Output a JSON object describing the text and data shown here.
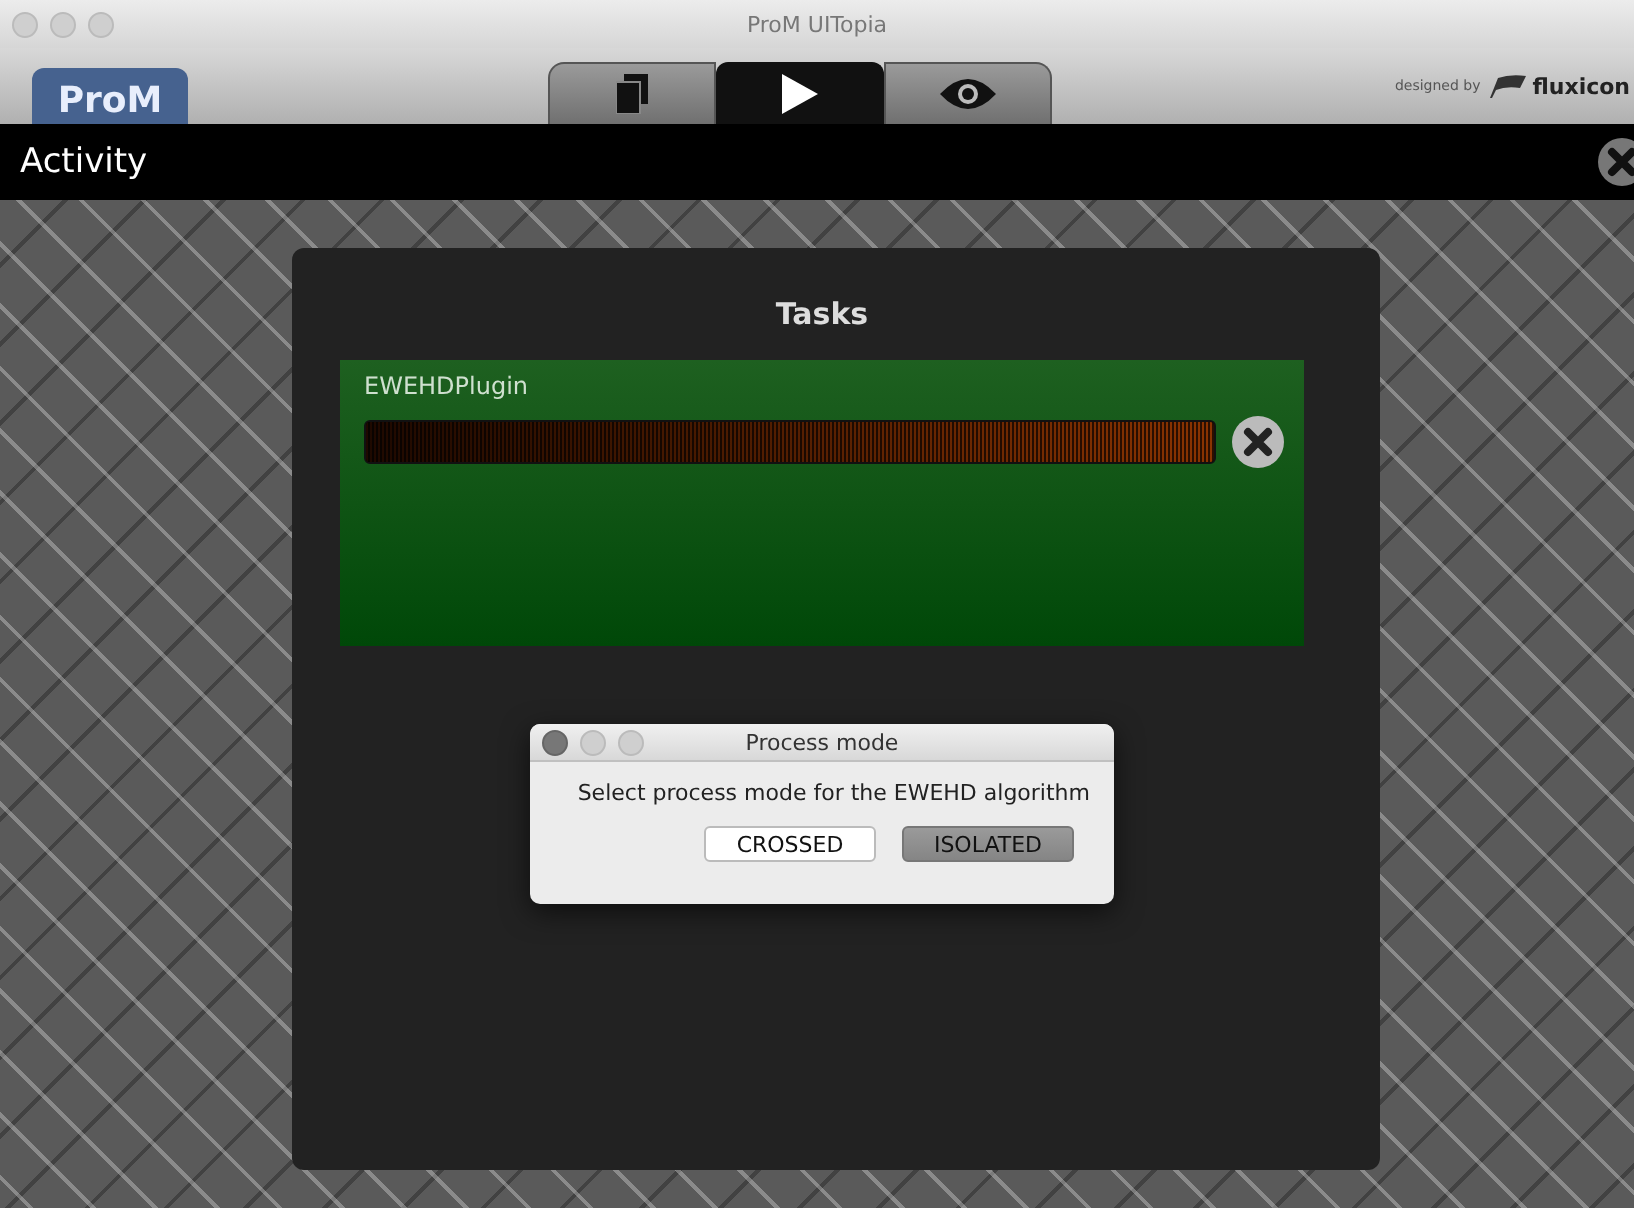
{
  "window": {
    "title": "ProM UITopia"
  },
  "toolbar": {
    "logo": "ProM",
    "tabs": [
      {
        "kind": "documents",
        "selected": false
      },
      {
        "kind": "play",
        "selected": true
      },
      {
        "kind": "view",
        "selected": false
      }
    ],
    "credit": "designed by",
    "brand": "fluxicon"
  },
  "activity_bar": {
    "title": "Activity"
  },
  "tasks_panel": {
    "title": "Tasks",
    "tasks": [
      {
        "name": "EWEHDPlugin",
        "level": 1
      }
    ]
  },
  "dialog": {
    "title": "Process mode",
    "message": "Select process mode for the EWEHD algorithm",
    "buttons": [
      {
        "label": "CROSSED",
        "selected": false
      },
      {
        "label": "ISOLATED",
        "selected": true
      }
    ]
  }
}
